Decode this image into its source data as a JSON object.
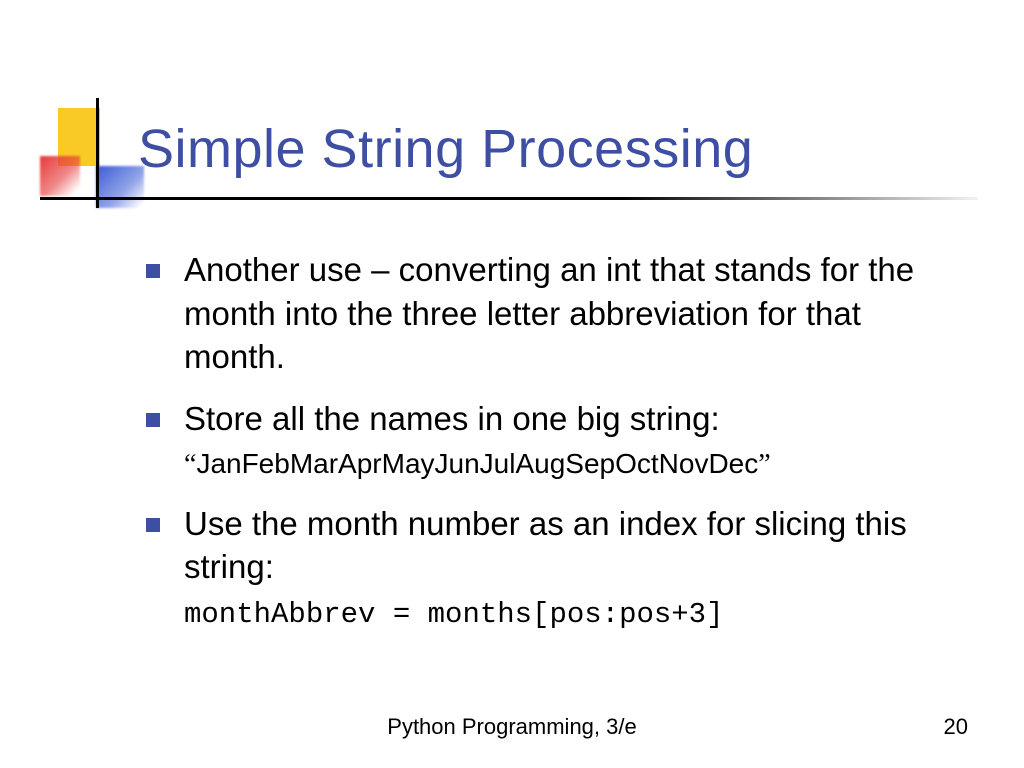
{
  "title": "Simple String Processing",
  "bullets": {
    "b1": "Another use – converting an int that stands for the month into the three letter abbreviation for that month.",
    "b2a": "Store all the names in one big string:",
    "b2b": "JanFebMarAprMayJunJulAugSepOctNovDec",
    "b3a": "Use the month number as an index for slicing this string:",
    "b3b": "monthAbbrev = months[pos:pos+3]"
  },
  "quote_open": "“",
  "quote_close": "”",
  "footer": {
    "text": "Python Programming, 3/e",
    "page": "20"
  }
}
